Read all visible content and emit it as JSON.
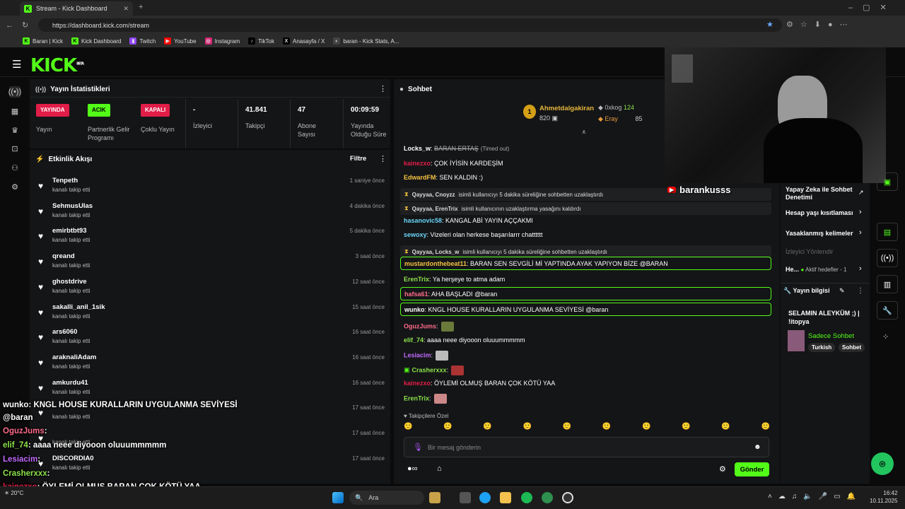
{
  "browser": {
    "tab_title": "Stream - Kick Dashboard",
    "url": "https://dashboard.kick.com/stream",
    "bookmarks": [
      "Baran | Kick",
      "Kick Dashboard",
      "Twitch",
      "YouTube",
      "Instagram",
      "TikTok",
      "Anasayfa / X",
      "baran - Kick Stats, A..."
    ]
  },
  "kick": {
    "logo": "KICK",
    "beta": "BETA"
  },
  "stats": {
    "title": "Yayın İstatistikleri",
    "live_badge": "YAYINDA",
    "live_label": "Yayın",
    "partner_badge": "ACIK",
    "partner_label": "Partnerlik Gelir Programı",
    "multi_badge": "KAPALI",
    "multi_label": "Çoklu Yayın",
    "viewers_val": "-",
    "viewers_label": "İzleyici",
    "followers_val": "41.841",
    "followers_label": "Takipçi",
    "subs_val": "47",
    "subs_label": "Abone Sayısı",
    "uptime_val": "00:09:59",
    "uptime_label": "Yayında Olduğu Süre"
  },
  "activity": {
    "title": "Etkinlik Akışı",
    "filter": "Filtre",
    "items": [
      {
        "name": "Tenpeth",
        "sub": "kanalı takip etti",
        "time": "1 saniye önce"
      },
      {
        "name": "SehmusUlas",
        "sub": "kanalı takip etti",
        "time": "4 dakika önce"
      },
      {
        "name": "emirbtbt93",
        "sub": "kanalı takip etti",
        "time": "5 dakika önce"
      },
      {
        "name": "qreand",
        "sub": "kanalı takip etti",
        "time": "3 saat önce"
      },
      {
        "name": "ghostdrive",
        "sub": "kanalı takip etti",
        "time": "12 saat önce"
      },
      {
        "name": "sakalli_anil_1sik",
        "sub": "kanalı takip etti",
        "time": "15 saat önce"
      },
      {
        "name": "ars6060",
        "sub": "kanalı takip etti",
        "time": "16 saat önce"
      },
      {
        "name": "araknaliAdam",
        "sub": "kanalı takip etti",
        "time": "16 saat önce"
      },
      {
        "name": "amkurdu41",
        "sub": "kanalı takip etti",
        "time": "16 saat önce"
      },
      {
        "name": "",
        "sub": "kanalı takip etti",
        "time": "17 saat önce"
      },
      {
        "name": "",
        "sub": "kanalı takip etti",
        "time": "17 saat önce"
      },
      {
        "name": "DISCORDIA0",
        "sub": "kanalı takip etti",
        "time": "17 saat önce"
      }
    ]
  },
  "chat": {
    "title": "Sohbet",
    "top1": {
      "rank": "1",
      "name": "Ahmetdalgakiran",
      "amount": "820"
    },
    "top2": {
      "name": "0xkog",
      "amount": "124"
    },
    "top3": {
      "name": "Eray",
      "amount": "85"
    },
    "lines": [
      {
        "user": "Locks_w",
        "msg": "BARAN ERTAŞ",
        "extra": "(Timed out)"
      },
      {
        "user": "kainezxo",
        "msg": ": ÇOK İYİSİN KARDEŞİM"
      },
      {
        "user": "EdwardFM",
        "msg": ": SEN KALDIN :)"
      },
      {
        "sys_user": "Qayyaa, Cnoyzz",
        "msg": "isimli kullanıcıyı 5 dakika süreliğine sohbetten uzaklaştırdı"
      },
      {
        "sys_user": "Qayyaa, ErenTrix",
        "msg": "isimli kullanıcının uzaklaştırma yasağını kaldırdı"
      },
      {
        "user": "hasanovic58",
        "msg": ": KANGAL ABİ YAYIN AÇÇAKMI"
      },
      {
        "user": "sewoxy",
        "msg": ": Vizeleri olan herkese başarılarrr chatttttt"
      },
      {
        "sys_user": "Qayyaa, Locks_w",
        "msg": "isimli kullanıcıyı 5 dakika süreliğine sohbetten uzaklaştırdı"
      },
      {
        "user": "mustardonthebeat11",
        "msg": ": BARAN SEN SEVGİLİ Mİ YAPTINDA AYAK YAPIYON BİZE @BARAN"
      },
      {
        "user": "ErenTrix",
        "msg": ": Ya herşeye to atma adam"
      },
      {
        "user": "hafsa61",
        "msg": ": AHA BAŞLADI @baran"
      },
      {
        "user": "wunko",
        "msg": ": KNGL HOUSE KURALLARIN UYGULANMA SEVİYESİ @baran"
      },
      {
        "user": "OguzJums",
        "msg": ":"
      },
      {
        "user": "elif_74",
        "msg": ": aaaa neee diyooon oluuummmmm"
      },
      {
        "user": "Lesiacim",
        "msg": ":"
      },
      {
        "user": "Crasherxxx",
        "msg": ":"
      },
      {
        "user": "kainezxo",
        "msg": ": ÖYLEMİ OLMUŞ BARAN ÇOK KÖTÜ YAA"
      },
      {
        "user": "ErenTrix",
        "msg": ":"
      }
    ],
    "followers_only": "Takipçilere Özel",
    "input_placeholder": "Bir mesaj gönderin",
    "send": "Gönder"
  },
  "right": {
    "ai_mod": "Yapay Zeka ile Sohbet Denetimi",
    "age": "Hesap yaşı kısıtlaması",
    "banned": "Yasaklanmış kelimeler",
    "viewer_redirect": "İzleyici Yönlendir",
    "goals": "He...",
    "goals_sub": "Aktif hedefler - 1",
    "stream_info": "Yayın bilgisi",
    "stream_title": "SELAMIN ALEYKÜM ;) | !itopya",
    "category": "Sadece Sohbet",
    "tags": [
      "Turkish",
      "Sohbet"
    ]
  },
  "webcam_name": "barankusss",
  "overlay": [
    {
      "user": "wunko",
      "msg": ": KNGL HOUSE KURALLARIN UYGULANMA SEVİYESİ"
    },
    {
      "user": "",
      "msg": "@baran"
    },
    {
      "user": "OguzJums",
      "msg": ":"
    },
    {
      "user": "elif_74",
      "msg": ": aaaa neee diyooon oluuummmmm"
    },
    {
      "user": "Lesiacim",
      "msg": ":"
    },
    {
      "user": "Crasherxxx",
      "msg": ":"
    },
    {
      "user": "kainezxo",
      "msg": ": ÖYLEMİ OLMUŞ BARAN ÇOK KÖTÜ YAA"
    },
    {
      "user": "ErenTrix",
      "msg": ":"
    }
  ],
  "taskbar": {
    "search": "Ara",
    "temp": "20°C",
    "time": "16:42",
    "date": "10.11.2025"
  },
  "colors": {
    "accent": "#53fc18",
    "live": "#e11d48"
  }
}
